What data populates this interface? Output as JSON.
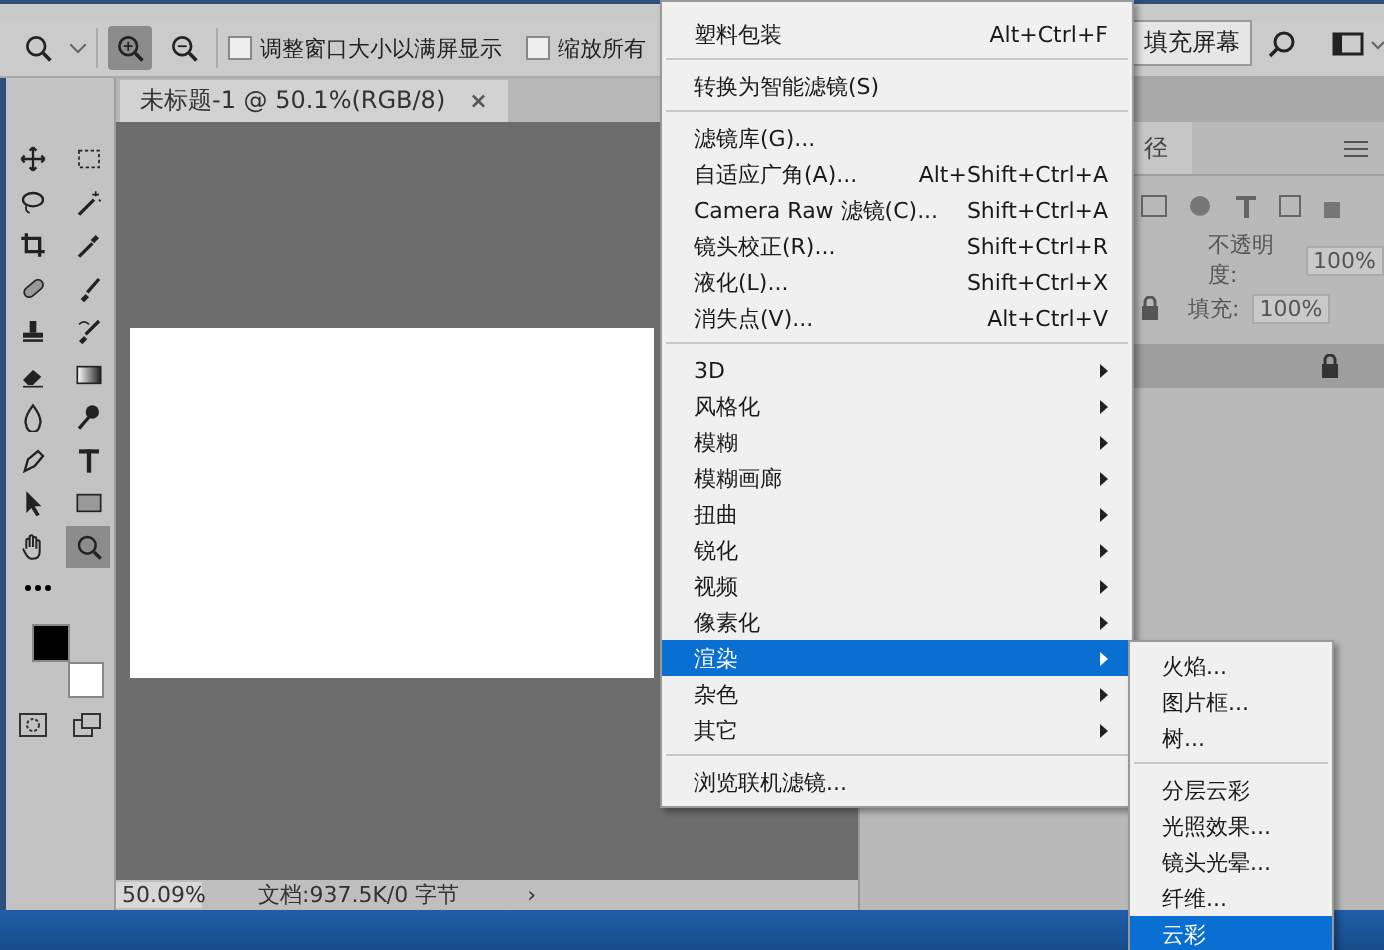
{
  "options_bar": {
    "zoom_buttons": [
      {
        "kind": "zoom-in",
        "selected": true
      },
      {
        "kind": "zoom-out",
        "selected": false
      }
    ],
    "checkboxes": [
      {
        "label": "调整窗口大小以满屏显示",
        "checked": false
      },
      {
        "label": "缩放所有",
        "checked": false
      }
    ],
    "fill_screen_button": "填充屏幕"
  },
  "document_tab": {
    "title": "未标题-1 @ 50.1%(RGB/8)",
    "close": "×"
  },
  "toolbox": {
    "tools": [
      {
        "kind": "move",
        "selected": false
      },
      {
        "kind": "marquee",
        "selected": false
      },
      {
        "kind": "lasso",
        "selected": false
      },
      {
        "kind": "wand",
        "selected": false
      },
      {
        "kind": "crop",
        "selected": false
      },
      {
        "kind": "eyedropper",
        "selected": false
      },
      {
        "kind": "bandage",
        "selected": false
      },
      {
        "kind": "brush",
        "selected": false
      },
      {
        "kind": "stamp",
        "selected": false
      },
      {
        "kind": "history-brush",
        "selected": false
      },
      {
        "kind": "eraser",
        "selected": false
      },
      {
        "kind": "gradient",
        "selected": false
      },
      {
        "kind": "drop",
        "selected": false
      },
      {
        "kind": "dodge",
        "selected": false
      },
      {
        "kind": "pen",
        "selected": false
      },
      {
        "kind": "type",
        "selected": false
      },
      {
        "kind": "pointer",
        "selected": false
      },
      {
        "kind": "rectangle",
        "selected": false
      },
      {
        "kind": "hand",
        "selected": false
      },
      {
        "kind": "zoom",
        "selected": true
      }
    ]
  },
  "status_bar": {
    "zoom": "50.09%",
    "info": "文档:937.5K/0 字节",
    "arrow": "›"
  },
  "layers_panel": {
    "tab": "径",
    "opacity_label": "不透明度:",
    "opacity": "100%",
    "fill_label": "填充:",
    "fill": "100%"
  },
  "filter_menu": {
    "items": [
      {
        "kind": "item",
        "label": "塑料包装",
        "shortcut": "Alt+Ctrl+F",
        "selected": false
      },
      {
        "kind": "separator"
      },
      {
        "kind": "item",
        "label": "转换为智能滤镜(S)",
        "selected": false
      },
      {
        "kind": "separator"
      },
      {
        "kind": "item",
        "label": "滤镜库(G)...",
        "selected": false
      },
      {
        "kind": "item",
        "label": "自适应广角(A)...",
        "shortcut": "Alt+Shift+Ctrl+A",
        "selected": false
      },
      {
        "kind": "item",
        "label": "Camera Raw 滤镜(C)...",
        "shortcut": "Shift+Ctrl+A",
        "selected": false
      },
      {
        "kind": "item",
        "label": "镜头校正(R)...",
        "shortcut": "Shift+Ctrl+R",
        "selected": false
      },
      {
        "kind": "item",
        "label": "液化(L)...",
        "shortcut": "Shift+Ctrl+X",
        "selected": false
      },
      {
        "kind": "item",
        "label": "消失点(V)...",
        "shortcut": "Alt+Ctrl+V",
        "selected": false
      },
      {
        "kind": "separator"
      },
      {
        "kind": "submenu",
        "label": "3D",
        "selected": false
      },
      {
        "kind": "submenu",
        "label": "风格化",
        "selected": false
      },
      {
        "kind": "submenu",
        "label": "模糊",
        "selected": false
      },
      {
        "kind": "submenu",
        "label": "模糊画廊",
        "selected": false
      },
      {
        "kind": "submenu",
        "label": "扭曲",
        "selected": false
      },
      {
        "kind": "submenu",
        "label": "锐化",
        "selected": false
      },
      {
        "kind": "submenu",
        "label": "视频",
        "selected": false
      },
      {
        "kind": "submenu",
        "label": "像素化",
        "selected": false
      },
      {
        "kind": "submenu",
        "label": "渲染",
        "selected": true
      },
      {
        "kind": "submenu",
        "label": "杂色",
        "selected": false
      },
      {
        "kind": "submenu",
        "label": "其它",
        "selected": false
      },
      {
        "kind": "separator"
      },
      {
        "kind": "item",
        "label": "浏览联机滤镜...",
        "selected": false
      }
    ]
  },
  "render_submenu": {
    "items": [
      {
        "kind": "item",
        "label": "火焰...",
        "selected": false
      },
      {
        "kind": "item",
        "label": "图片框...",
        "selected": false
      },
      {
        "kind": "item",
        "label": "树...",
        "selected": false
      },
      {
        "kind": "separator"
      },
      {
        "kind": "item",
        "label": "分层云彩",
        "selected": false
      },
      {
        "kind": "item",
        "label": "光照效果...",
        "selected": false
      },
      {
        "kind": "item",
        "label": "镜头光晕...",
        "selected": false
      },
      {
        "kind": "item",
        "label": "纤维...",
        "selected": false
      },
      {
        "kind": "item",
        "label": "云彩",
        "selected": true
      }
    ]
  }
}
